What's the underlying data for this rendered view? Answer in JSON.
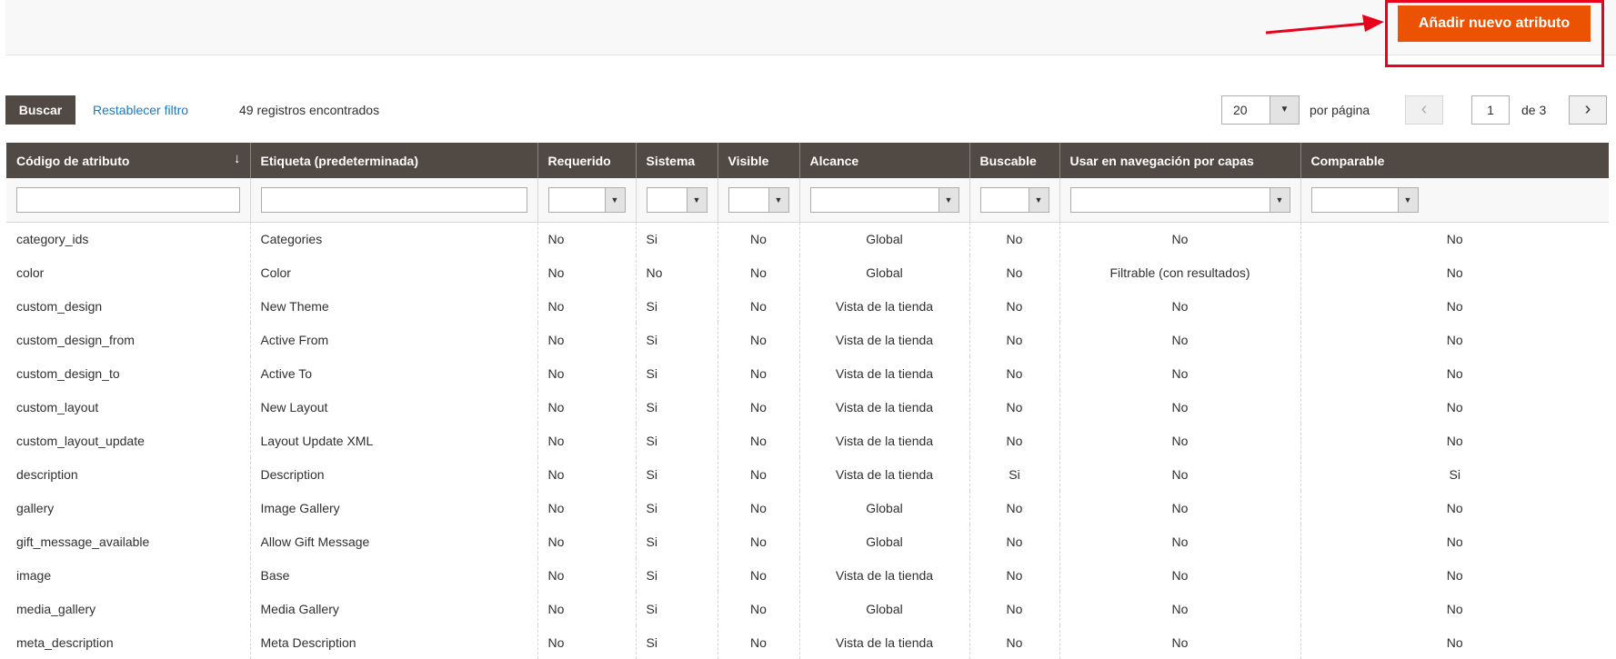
{
  "header": {
    "add_button_label": "Añadir nuevo atributo"
  },
  "toolbar": {
    "search_label": "Buscar",
    "reset_label": "Restablecer filtro",
    "records_text": "49 registros encontrados",
    "per_page_value": "20",
    "per_page_label": "por página",
    "current_page": "1",
    "of_label": "de 3"
  },
  "grid": {
    "columns": [
      "Código de atributo",
      "Etiqueta (predeterminada)",
      "Requerido",
      "Sistema",
      "Visible",
      "Alcance",
      "Buscable",
      "Usar en navegación por capas",
      "Comparable"
    ],
    "sort_indicator": "↓",
    "rows": [
      [
        "category_ids",
        "Categories",
        "No",
        "Si",
        "No",
        "Global",
        "No",
        "No",
        "No"
      ],
      [
        "color",
        "Color",
        "No",
        "No",
        "No",
        "Global",
        "No",
        "Filtrable (con resultados)",
        "No"
      ],
      [
        "custom_design",
        "New Theme",
        "No",
        "Si",
        "No",
        "Vista de la tienda",
        "No",
        "No",
        "No"
      ],
      [
        "custom_design_from",
        "Active From",
        "No",
        "Si",
        "No",
        "Vista de la tienda",
        "No",
        "No",
        "No"
      ],
      [
        "custom_design_to",
        "Active To",
        "No",
        "Si",
        "No",
        "Vista de la tienda",
        "No",
        "No",
        "No"
      ],
      [
        "custom_layout",
        "New Layout",
        "No",
        "Si",
        "No",
        "Vista de la tienda",
        "No",
        "No",
        "No"
      ],
      [
        "custom_layout_update",
        "Layout Update XML",
        "No",
        "Si",
        "No",
        "Vista de la tienda",
        "No",
        "No",
        "No"
      ],
      [
        "description",
        "Description",
        "No",
        "Si",
        "No",
        "Vista de la tienda",
        "Si",
        "No",
        "Si"
      ],
      [
        "gallery",
        "Image Gallery",
        "No",
        "Si",
        "No",
        "Global",
        "No",
        "No",
        "No"
      ],
      [
        "gift_message_available",
        "Allow Gift Message",
        "No",
        "Si",
        "No",
        "Global",
        "No",
        "No",
        "No"
      ],
      [
        "image",
        "Base",
        "No",
        "Si",
        "No",
        "Vista de la tienda",
        "No",
        "No",
        "No"
      ],
      [
        "media_gallery",
        "Media Gallery",
        "No",
        "Si",
        "No",
        "Global",
        "No",
        "No",
        "No"
      ],
      [
        "meta_description",
        "Meta Description",
        "No",
        "Si",
        "No",
        "Vista de la tienda",
        "No",
        "No",
        "No"
      ]
    ]
  },
  "colors": {
    "accent": "#eb5202",
    "header_bg": "#514943",
    "link": "#1979c3",
    "highlight": "#e8001c"
  }
}
